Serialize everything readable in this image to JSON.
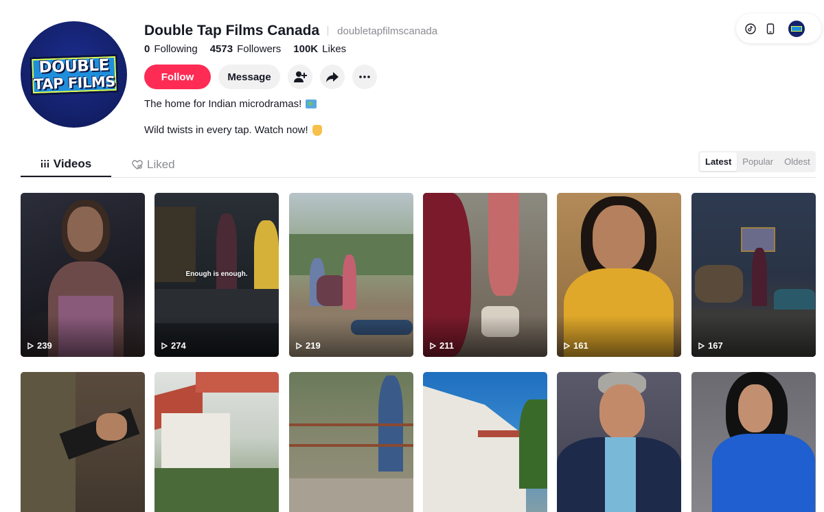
{
  "profile": {
    "display_name": "Double Tap Films Canada",
    "username": "doubletapfilmscanada",
    "logo_line1": "DOUBLE",
    "logo_line2": "TAP FILMS",
    "stats": {
      "following_count": "0",
      "following_label": "Following",
      "followers_count": "4573",
      "followers_label": "Followers",
      "likes_count": "100K",
      "likes_label": "Likes"
    },
    "bio_line1": "The home for Indian microdramas!",
    "bio_line2": "Wild twists in every tap. Watch now!"
  },
  "actions": {
    "follow_label": "Follow",
    "message_label": "Message",
    "icons": [
      "add-friend-icon",
      "share-icon",
      "more-icon"
    ]
  },
  "top_pill": {
    "icons": [
      "tiktok-icon",
      "phone-icon",
      "profile-avatar"
    ]
  },
  "tabs": {
    "videos_label": "Videos",
    "liked_label": "Liked",
    "active": "Videos"
  },
  "sort": {
    "options": [
      "Latest",
      "Popular",
      "Oldest"
    ],
    "selected": "Latest"
  },
  "videos": [
    {
      "views": "239",
      "caption": ""
    },
    {
      "views": "274",
      "caption": "Enough is enough."
    },
    {
      "views": "219",
      "caption": ""
    },
    {
      "views": "211",
      "caption": ""
    },
    {
      "views": "161",
      "caption": ""
    },
    {
      "views": "167",
      "caption": ""
    },
    {
      "views": "",
      "caption": ""
    },
    {
      "views": "",
      "caption": ""
    },
    {
      "views": "",
      "caption": ""
    },
    {
      "views": "",
      "caption": ""
    },
    {
      "views": "",
      "caption": ""
    },
    {
      "views": "",
      "caption": ""
    }
  ],
  "colors": {
    "accent": "#fe2c55",
    "text_primary": "#161823",
    "text_secondary": "#8a8b91",
    "button_bg": "#f1f1f2"
  }
}
